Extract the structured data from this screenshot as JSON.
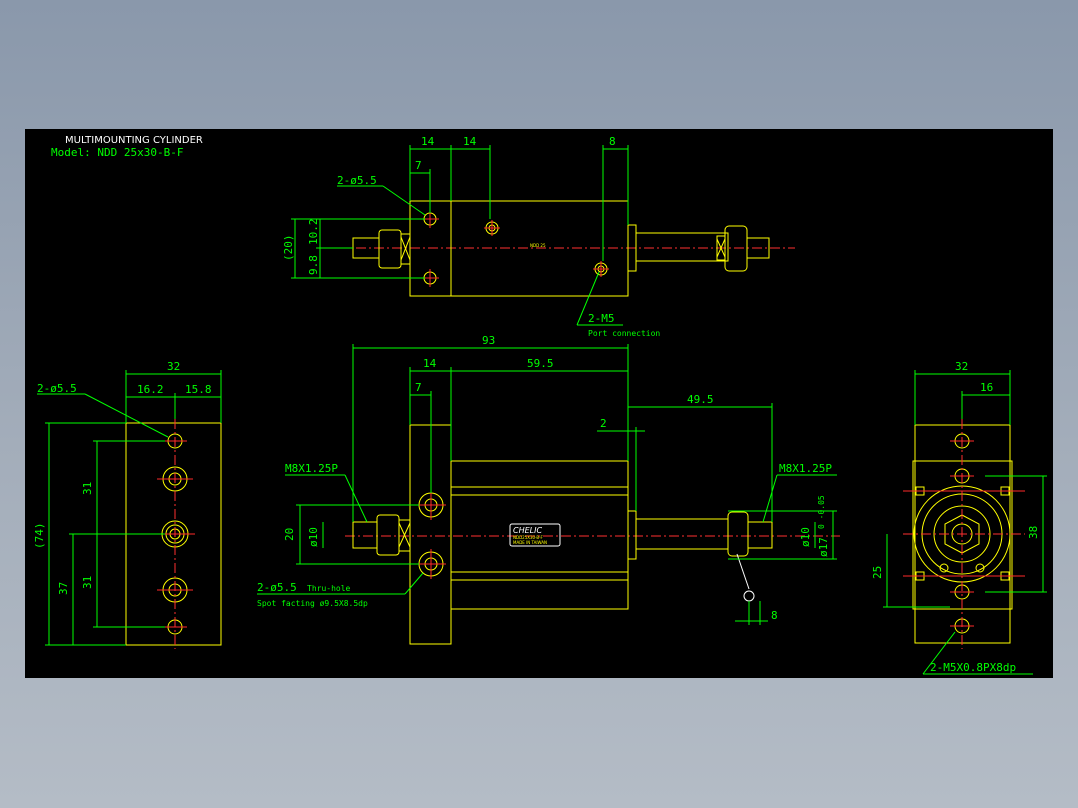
{
  "drawing": {
    "title": "MULTIMOUNTING CYLINDER",
    "model": "Model: NDD 25x30-B-F"
  },
  "top_view": {
    "dims": {
      "d14a": "14",
      "d14b": "14",
      "d8": "8",
      "d7": "7",
      "d20": "(20)",
      "d10_2": "10.2",
      "d9_8": "9.8"
    },
    "hole_label": "2-ø5.5",
    "port_label": "2-M5",
    "port_sub": "Port connection",
    "body_text": "NDD 25"
  },
  "front_view": {
    "dims": {
      "d93": "93",
      "d14": "14",
      "d59_5": "59.5",
      "d7": "7",
      "d2": "2",
      "d49_5": "49.5",
      "d20": "20",
      "d10l": "ø10",
      "d10r": "ø10",
      "d17": "ø17",
      "d17tol": "0 -0.05",
      "d8": "8"
    },
    "thread_left": "M8X1.25P",
    "thread_right": "M8X1.25P",
    "hole_label": "2-ø5.5",
    "hole_thru": "Thru-hole",
    "spot": "Spot facting   ø9.5X8.5dp",
    "logo": "CHELIC",
    "label_line1": "NDD25X30-B-F",
    "label_line2": "MADE IN TAIWAN"
  },
  "left_view": {
    "dims": {
      "d32": "32",
      "d16_2": "16.2",
      "d15_8": "15.8",
      "d74": "(74)",
      "d37": "37",
      "d31a": "31",
      "d31b": "31"
    },
    "hole_label": "2-ø5.5"
  },
  "right_view": {
    "dims": {
      "d32": "32",
      "d16": "16",
      "d38": "38",
      "d25": "25"
    },
    "tap_label": "2-M5X0.8PX8dp"
  }
}
